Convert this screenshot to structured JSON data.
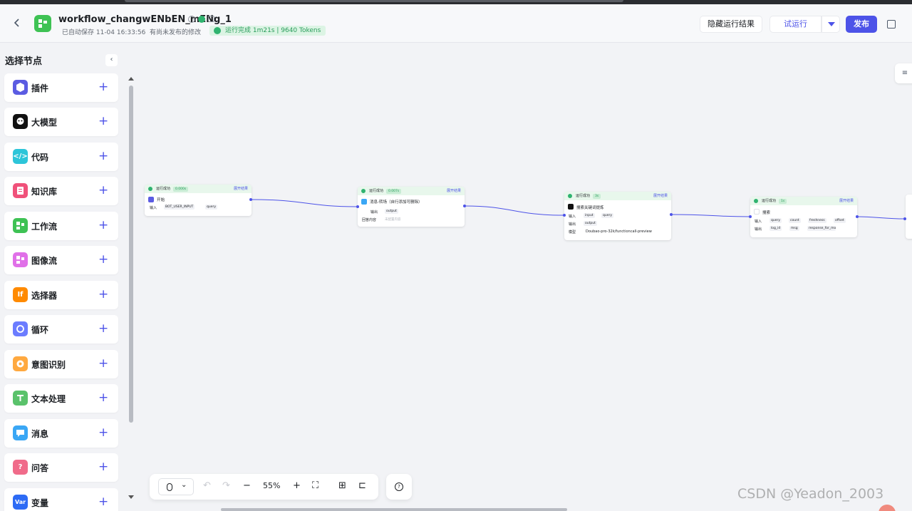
{
  "header": {
    "title": "workflow_changwENbEN_mENg_1",
    "saved": "已自动保存 11-04 16:33:56",
    "unpublished": "有尚未发布的修改",
    "run_status": "运行完成 1m21s | 9640 Tokens",
    "hide_results_label": "隐藏运行结果",
    "test_run_label": "试运行",
    "publish_label": "发布"
  },
  "sidebar": {
    "title": "选择节点",
    "items": [
      {
        "label": "插件",
        "icon": "plugin-icon",
        "color": "#5b5ce2"
      },
      {
        "label": "大模型",
        "icon": "llm-icon",
        "color": "#111111"
      },
      {
        "label": "代码",
        "icon": "code-icon",
        "color": "#2dc5d9"
      },
      {
        "label": "知识库",
        "icon": "knowledge-icon",
        "color": "#f0517a"
      },
      {
        "label": "工作流",
        "icon": "workflow-icon",
        "color": "#3ec254"
      },
      {
        "label": "图像流",
        "icon": "imageflow-icon",
        "color": "#e070e8"
      },
      {
        "label": "选择器",
        "icon": "if-icon",
        "color": "#ff8a00"
      },
      {
        "label": "循环",
        "icon": "loop-icon",
        "color": "#6b7cff"
      },
      {
        "label": "意图识别",
        "icon": "intent-icon",
        "color": "#ffa940"
      },
      {
        "label": "文本处理",
        "icon": "text-icon",
        "color": "#5ac26b"
      },
      {
        "label": "消息",
        "icon": "message-icon",
        "color": "#3aa7f5"
      },
      {
        "label": "问答",
        "icon": "qa-icon",
        "color": "#f06b8a"
      },
      {
        "label": "变量",
        "icon": "var-icon",
        "color": "#2d6bf5"
      }
    ],
    "if_glyph": "If",
    "var_glyph": "Var"
  },
  "nodes": {
    "status": "运行成功",
    "expand": "展开结果",
    "start": {
      "time": "0.000s",
      "title": "开始",
      "input_label": "输入",
      "tag1": "BOT_USER_INPUT",
      "tag2": "query"
    },
    "message": {
      "time": "0.007s",
      "title": "消息-转场（自行添加可删除）",
      "output_label": "输出",
      "out_tag": "output",
      "reply_label": "回答内容",
      "reply_hint": "未配置内容"
    },
    "llm": {
      "time": "3s",
      "title": "搜索关键词提炼",
      "input_label": "输入",
      "in1": "input",
      "in2": "query",
      "output_label": "输出",
      "out1": "output",
      "model_label": "模型",
      "model": "Doubao-pro-32k/functioncall-preview"
    },
    "search": {
      "time": "1s",
      "title": "搜索",
      "input_label": "输入",
      "in1": "query",
      "in2": "count",
      "in3": "freshness",
      "in4": "offset",
      "output_label": "输出",
      "out1": "log_id",
      "out2": "msg",
      "out3": "response_for_model"
    }
  },
  "toolbar": {
    "zoom": "55%"
  },
  "watermark": "CSDN @Yeadon_2003"
}
